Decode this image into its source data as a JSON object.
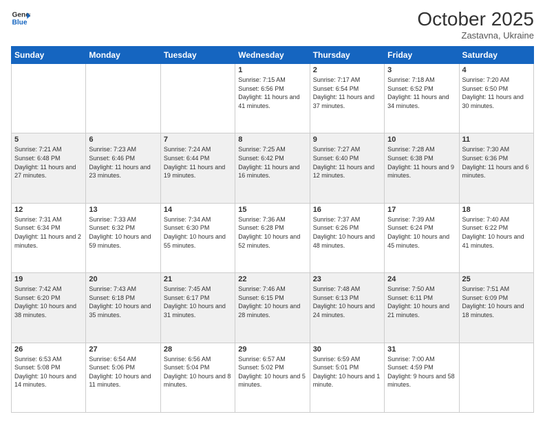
{
  "header": {
    "logo_line1": "General",
    "logo_line2": "Blue",
    "month": "October 2025",
    "location": "Zastavna, Ukraine"
  },
  "weekdays": [
    "Sunday",
    "Monday",
    "Tuesday",
    "Wednesday",
    "Thursday",
    "Friday",
    "Saturday"
  ],
  "weeks": [
    [
      {
        "day": "",
        "text": ""
      },
      {
        "day": "",
        "text": ""
      },
      {
        "day": "",
        "text": ""
      },
      {
        "day": "1",
        "text": "Sunrise: 7:15 AM\nSunset: 6:56 PM\nDaylight: 11 hours and 41 minutes."
      },
      {
        "day": "2",
        "text": "Sunrise: 7:17 AM\nSunset: 6:54 PM\nDaylight: 11 hours and 37 minutes."
      },
      {
        "day": "3",
        "text": "Sunrise: 7:18 AM\nSunset: 6:52 PM\nDaylight: 11 hours and 34 minutes."
      },
      {
        "day": "4",
        "text": "Sunrise: 7:20 AM\nSunset: 6:50 PM\nDaylight: 11 hours and 30 minutes."
      }
    ],
    [
      {
        "day": "5",
        "text": "Sunrise: 7:21 AM\nSunset: 6:48 PM\nDaylight: 11 hours and 27 minutes."
      },
      {
        "day": "6",
        "text": "Sunrise: 7:23 AM\nSunset: 6:46 PM\nDaylight: 11 hours and 23 minutes."
      },
      {
        "day": "7",
        "text": "Sunrise: 7:24 AM\nSunset: 6:44 PM\nDaylight: 11 hours and 19 minutes."
      },
      {
        "day": "8",
        "text": "Sunrise: 7:25 AM\nSunset: 6:42 PM\nDaylight: 11 hours and 16 minutes."
      },
      {
        "day": "9",
        "text": "Sunrise: 7:27 AM\nSunset: 6:40 PM\nDaylight: 11 hours and 12 minutes."
      },
      {
        "day": "10",
        "text": "Sunrise: 7:28 AM\nSunset: 6:38 PM\nDaylight: 11 hours and 9 minutes."
      },
      {
        "day": "11",
        "text": "Sunrise: 7:30 AM\nSunset: 6:36 PM\nDaylight: 11 hours and 6 minutes."
      }
    ],
    [
      {
        "day": "12",
        "text": "Sunrise: 7:31 AM\nSunset: 6:34 PM\nDaylight: 11 hours and 2 minutes."
      },
      {
        "day": "13",
        "text": "Sunrise: 7:33 AM\nSunset: 6:32 PM\nDaylight: 10 hours and 59 minutes."
      },
      {
        "day": "14",
        "text": "Sunrise: 7:34 AM\nSunset: 6:30 PM\nDaylight: 10 hours and 55 minutes."
      },
      {
        "day": "15",
        "text": "Sunrise: 7:36 AM\nSunset: 6:28 PM\nDaylight: 10 hours and 52 minutes."
      },
      {
        "day": "16",
        "text": "Sunrise: 7:37 AM\nSunset: 6:26 PM\nDaylight: 10 hours and 48 minutes."
      },
      {
        "day": "17",
        "text": "Sunrise: 7:39 AM\nSunset: 6:24 PM\nDaylight: 10 hours and 45 minutes."
      },
      {
        "day": "18",
        "text": "Sunrise: 7:40 AM\nSunset: 6:22 PM\nDaylight: 10 hours and 41 minutes."
      }
    ],
    [
      {
        "day": "19",
        "text": "Sunrise: 7:42 AM\nSunset: 6:20 PM\nDaylight: 10 hours and 38 minutes."
      },
      {
        "day": "20",
        "text": "Sunrise: 7:43 AM\nSunset: 6:18 PM\nDaylight: 10 hours and 35 minutes."
      },
      {
        "day": "21",
        "text": "Sunrise: 7:45 AM\nSunset: 6:17 PM\nDaylight: 10 hours and 31 minutes."
      },
      {
        "day": "22",
        "text": "Sunrise: 7:46 AM\nSunset: 6:15 PM\nDaylight: 10 hours and 28 minutes."
      },
      {
        "day": "23",
        "text": "Sunrise: 7:48 AM\nSunset: 6:13 PM\nDaylight: 10 hours and 24 minutes."
      },
      {
        "day": "24",
        "text": "Sunrise: 7:50 AM\nSunset: 6:11 PM\nDaylight: 10 hours and 21 minutes."
      },
      {
        "day": "25",
        "text": "Sunrise: 7:51 AM\nSunset: 6:09 PM\nDaylight: 10 hours and 18 minutes."
      }
    ],
    [
      {
        "day": "26",
        "text": "Sunrise: 6:53 AM\nSunset: 5:08 PM\nDaylight: 10 hours and 14 minutes."
      },
      {
        "day": "27",
        "text": "Sunrise: 6:54 AM\nSunset: 5:06 PM\nDaylight: 10 hours and 11 minutes."
      },
      {
        "day": "28",
        "text": "Sunrise: 6:56 AM\nSunset: 5:04 PM\nDaylight: 10 hours and 8 minutes."
      },
      {
        "day": "29",
        "text": "Sunrise: 6:57 AM\nSunset: 5:02 PM\nDaylight: 10 hours and 5 minutes."
      },
      {
        "day": "30",
        "text": "Sunrise: 6:59 AM\nSunset: 5:01 PM\nDaylight: 10 hours and 1 minute."
      },
      {
        "day": "31",
        "text": "Sunrise: 7:00 AM\nSunset: 4:59 PM\nDaylight: 9 hours and 58 minutes."
      },
      {
        "day": "",
        "text": ""
      }
    ]
  ]
}
